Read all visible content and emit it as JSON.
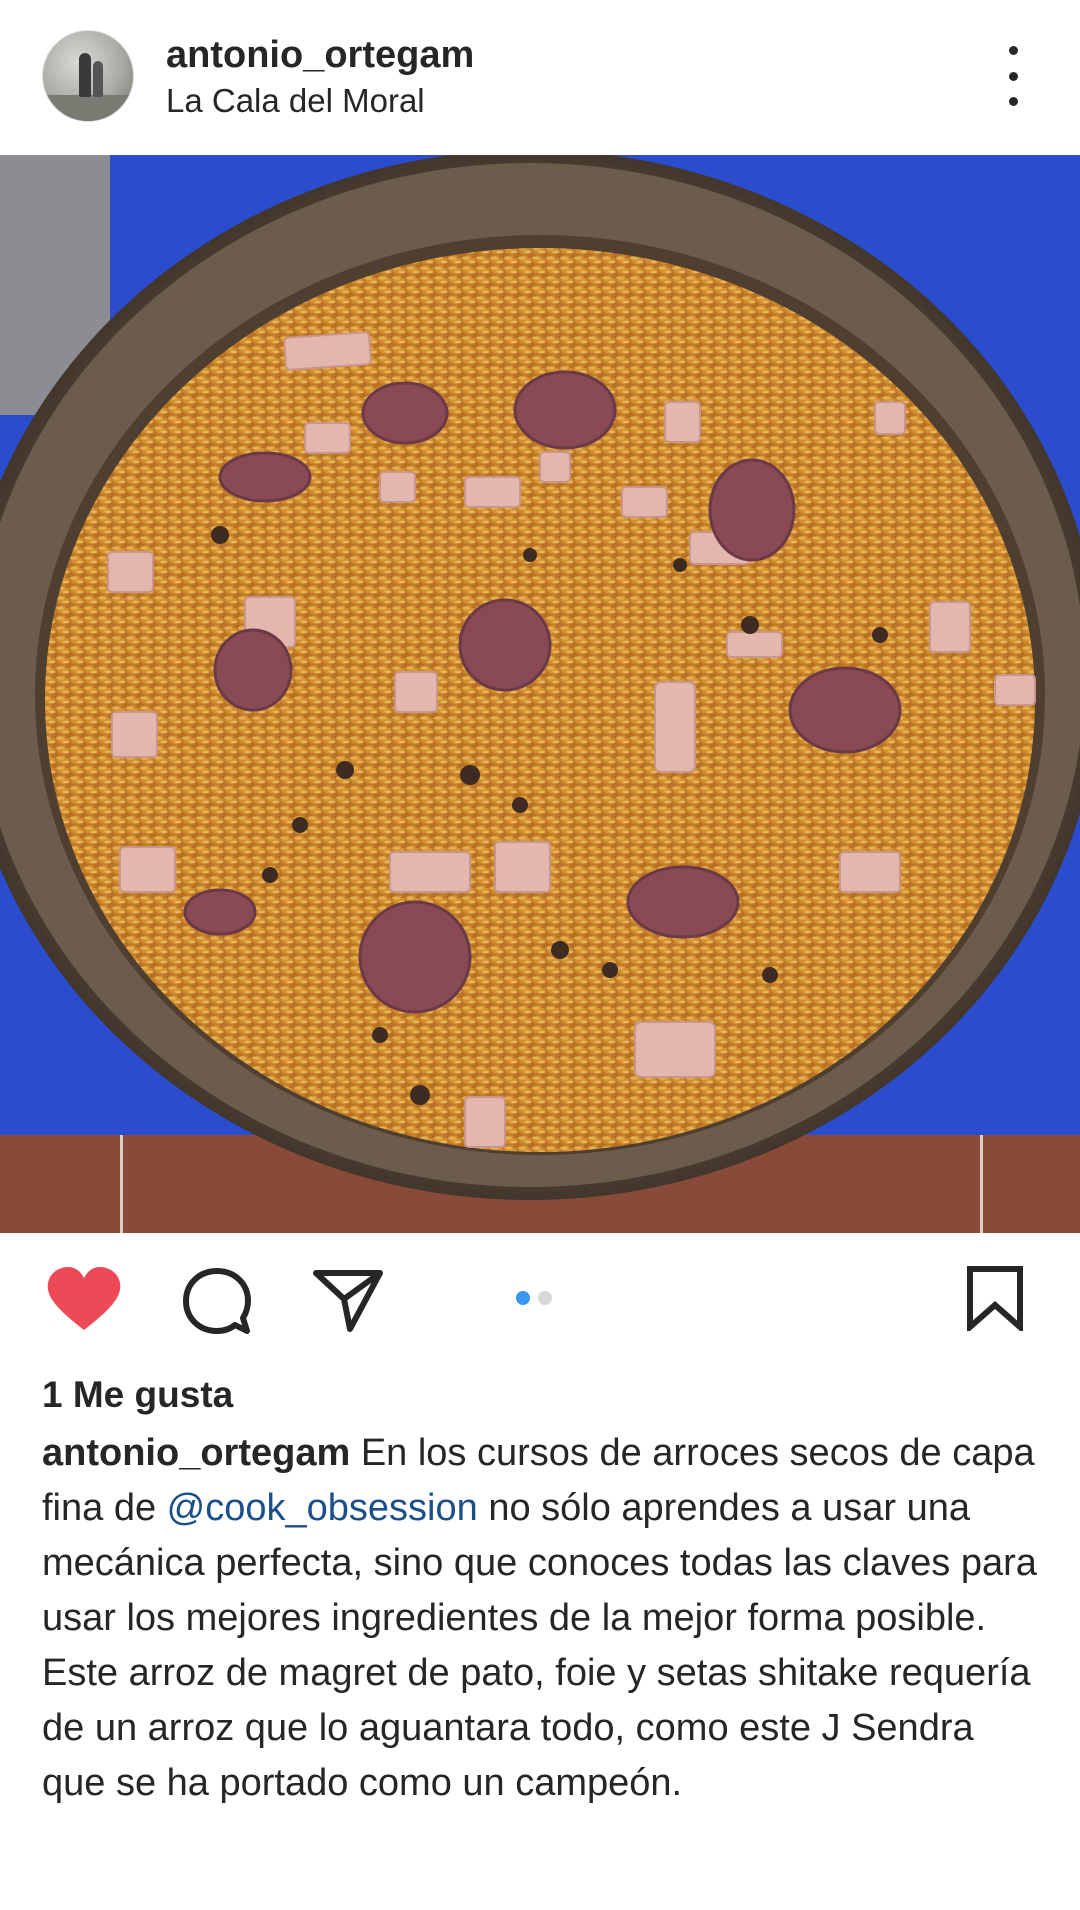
{
  "post": {
    "username": "antonio_ortegam",
    "location": "La Cala del Moral",
    "likes": "1 Me gusta",
    "caption": {
      "username": "antonio_ortegam",
      "text_before": "En los cursos de arroces secos de capa fina de",
      "mention": "@cook_obsession",
      "text_after": "no sólo aprendes a usar una mecánica perfecta, sino que conoces todas las claves para usar los mejores ingredientes de la mejor forma posible. Este arroz de magret de pato, foie y setas shitake requería de un arroz que lo aguantara todo, como este J Sendra que se ha portado como un campeón."
    },
    "carousel": {
      "current": 1,
      "total": 2
    },
    "liked": true
  },
  "icons": {
    "more": "more-options-icon",
    "like": "heart-icon",
    "comment": "comment-icon",
    "share": "paper-plane-icon",
    "save": "bookmark-icon"
  },
  "colors": {
    "like_red": "#ed4956",
    "carousel_active": "#3897f0",
    "mention": "#1b4f8a"
  }
}
